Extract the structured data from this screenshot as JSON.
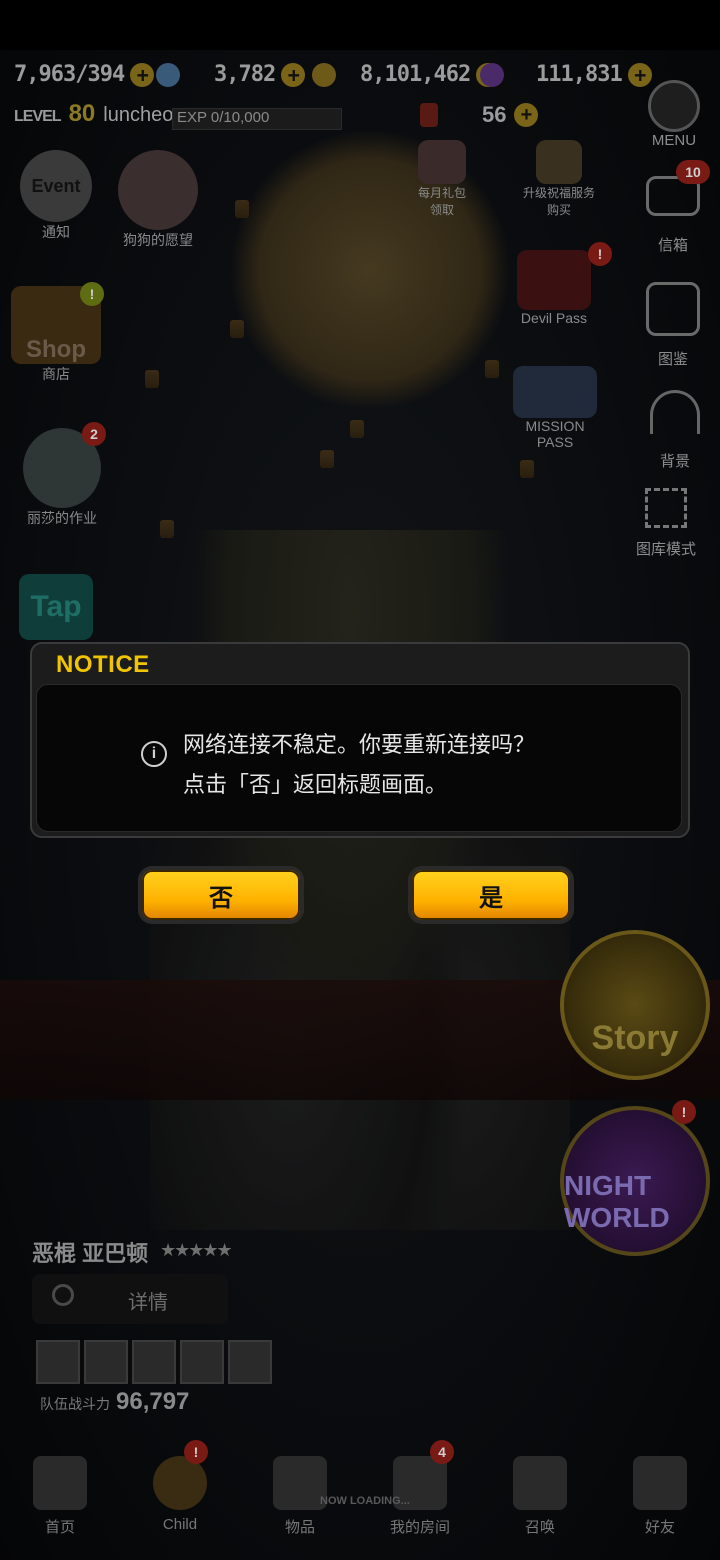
{
  "hud": {
    "hp": "7,963/394",
    "gem": "3,782",
    "gold": "8,101,462",
    "crystal": "111,831",
    "level_label": "LEVEL",
    "level_value": "80",
    "player_name": "luncheon",
    "exp_text": "EXP 0/10,000",
    "stamina": "56",
    "plus_symbol": "+"
  },
  "left_icons": {
    "event_label": "通知",
    "event_pic": "Event",
    "wish_label": "狗狗的愿望",
    "shop_label": "商店",
    "shop_pic": "Shop",
    "homework_label": "丽莎的作业",
    "homework_badge": "2",
    "tap_label": "Tap"
  },
  "middle_icons": {
    "monthly_label": "每月礼包\n领取",
    "upgrade_label": "升级祝福服务\n购买",
    "devil_pass_label": "Devil Pass",
    "mission_pass_label": "MISSION\nPASS"
  },
  "right_icons": {
    "menu_label": "MENU",
    "mail_label": "信箱",
    "mail_badge": "10",
    "collection_label": "图鉴",
    "background_label": "背景",
    "gallery_label": "图库模式"
  },
  "dialog": {
    "title": "NOTICE",
    "message_line1": "网络连接不稳定。你要重新连接吗？",
    "message_line2": "点击「否」返回标题画面。",
    "no_button": "否",
    "yes_button": "是"
  },
  "big_buttons": {
    "story": "Story",
    "night_world": "NIGHT WORLD"
  },
  "bottom": {
    "char_name": "恶棍 亚巴顿",
    "stars": "★★★★★",
    "details_label": "详情",
    "team_power_label": "队伍战斗力",
    "team_power_value": "96,797",
    "loading_text": "NOW LOADING..."
  },
  "nav": {
    "home": "首页",
    "child": "Child",
    "items": "物品",
    "my_room": "我的房间",
    "my_room_badge": "4",
    "summon": "召唤",
    "friends": "好友"
  },
  "colors": {
    "accent": "#f0c400",
    "button_gold": "#ffb300",
    "badge_red": "#7a1a14"
  }
}
